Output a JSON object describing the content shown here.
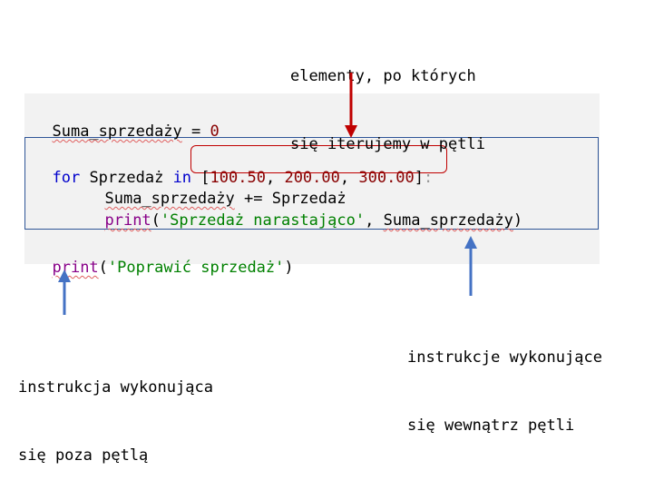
{
  "code": {
    "line1": {
      "var": "Suma_sprzedaży",
      "op": " = ",
      "val": "0"
    },
    "line2": {
      "kw_for": "for",
      "var": " Sprzedaż ",
      "kw_in": "in",
      "pad": " ",
      "open": "[",
      "n1": "100.50",
      "sep1": ", ",
      "n2": "200.00",
      "sep2": ", ",
      "n3": "300.00",
      "close": "]",
      "colon": ":"
    },
    "line3": {
      "var": "Suma_sprzedaży",
      "rest": " += Sprzedaż"
    },
    "line4": {
      "fn": "print",
      "open": "(",
      "str": "'Sprzedaż narastająco'",
      "sep": ", ",
      "arg": "Suma_sprzedaży",
      "close": ")"
    },
    "line5": {
      "fn": "print",
      "open": "(",
      "str": "'Poprawić sprzedaż'",
      "close": ")"
    }
  },
  "annotations": {
    "top": [
      "elementy, po których",
      "się iterujemy w pętli"
    ],
    "right": [
      "instrukcje wykonujące",
      "się wewnątrz pętli"
    ],
    "left": [
      "instrukcja wykonująca",
      "się poza pętlą"
    ]
  },
  "colors": {
    "keyword": "#0000cc",
    "number": "#880000",
    "string": "#008000",
    "builtin": "#880088",
    "red_arrow": "#c00000",
    "blue_arrow": "#4472c4",
    "loop_border": "#2f5597"
  }
}
